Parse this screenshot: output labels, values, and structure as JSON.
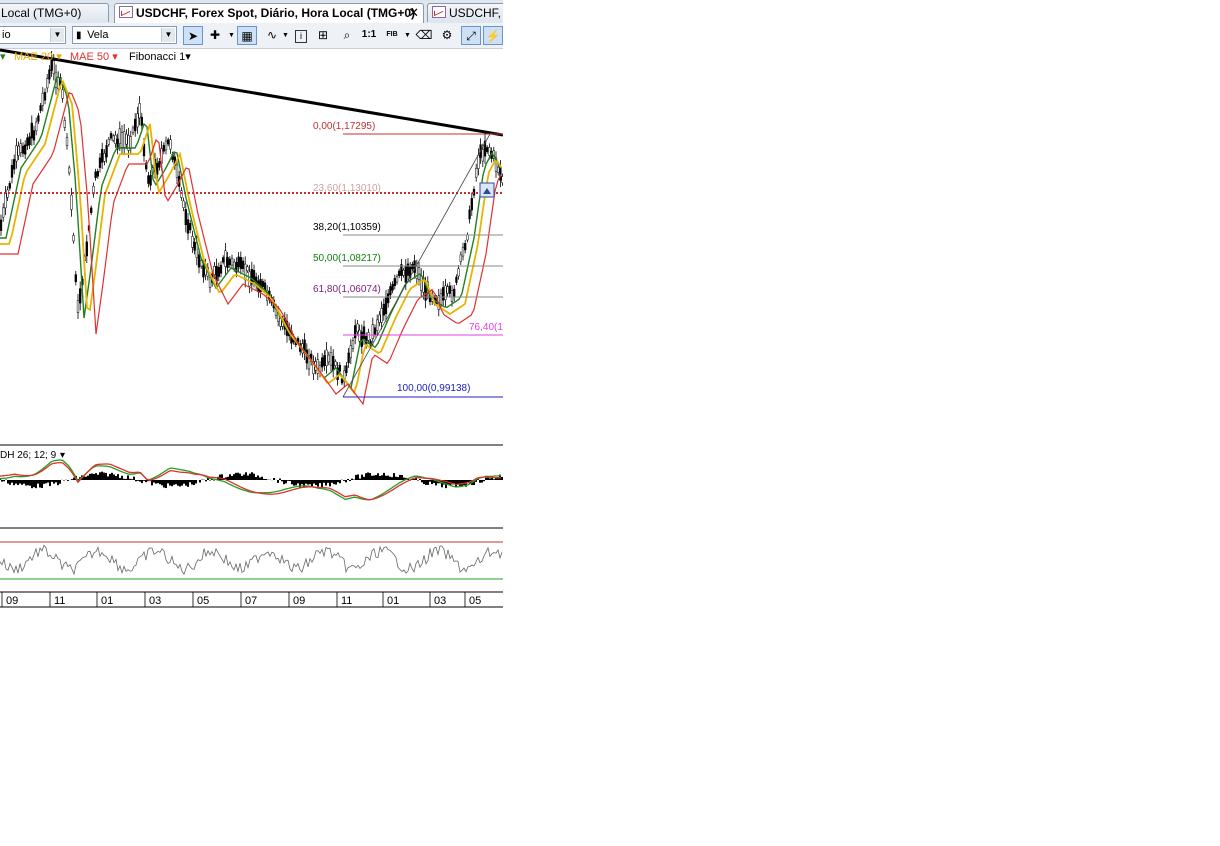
{
  "tabs": [
    {
      "label": "Local (TMG+0)"
    },
    {
      "label": "USDCHF, Forex Spot, Diário, Hora Local (TMG+0)",
      "close": "✕"
    },
    {
      "label": "USDCHF, Fo"
    }
  ],
  "toolbar": {
    "period_value": "io",
    "chart_type_value": "Vela",
    "ratio_label": "1:1",
    "fib_label": "FIB"
  },
  "indicators": [
    {
      "label": "MAE 20",
      "color": "#e8a800"
    },
    {
      "label": "MAE 50",
      "color": "#e03030"
    },
    {
      "label": "Fibonacci 1",
      "color": "#000000"
    }
  ],
  "fibonacci": [
    {
      "label": "0,00(1,17295)",
      "color": "#c03030"
    },
    {
      "label": "23,60(1,13010)",
      "color": "#d0a0a0"
    },
    {
      "label": "38,20(1,10359)",
      "color": "#000000"
    },
    {
      "label": "50,00(1,08217)",
      "color": "#108010"
    },
    {
      "label": "61,80(1,06074)",
      "color": "#802080"
    },
    {
      "label": "76,40(1",
      "color": "#e040e0"
    },
    {
      "label": "100,00(0,99138)",
      "color": "#2020c0"
    }
  ],
  "macd_label": "DH 26; 12; 9",
  "time_axis": [
    "09",
    "11",
    "01",
    "03",
    "05",
    "07",
    "09",
    "11",
    "01",
    "03",
    "05"
  ],
  "colors": {
    "ema20": "#e8b400",
    "ema50": "#e03030",
    "ema_fast": "#208020",
    "trendline": "#000000",
    "rsi_upper": "#c03030",
    "rsi_lower": "#20a020"
  }
}
